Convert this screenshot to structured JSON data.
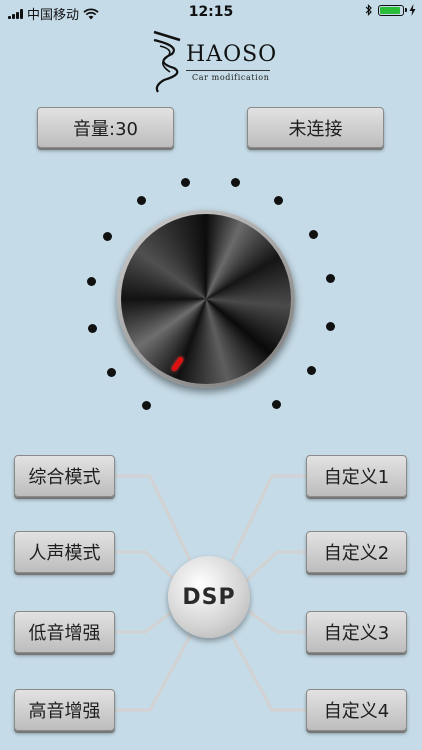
{
  "status_bar": {
    "carrier": "中国移动",
    "time": "12:15",
    "battery_level": 1.0,
    "battery_color": "#2bbd3a"
  },
  "logo": {
    "brand": "HAOSO",
    "tagline": "Car  modification"
  },
  "top_buttons": {
    "volume_label": "音量:30",
    "connection_label": "未连接"
  },
  "knob": {
    "indicator_color": "#e01010"
  },
  "dsp": {
    "center_label": "DSP",
    "left_modes": [
      "综合模式",
      "人声模式",
      "低音增强",
      "高音增强"
    ],
    "right_modes": [
      "自定义1",
      "自定义2",
      "自定义3",
      "自定义4"
    ]
  },
  "colors": {
    "background": "#c5dbe7",
    "button_face": "#d0d0d0",
    "connector_line": "#cfcfcf"
  }
}
